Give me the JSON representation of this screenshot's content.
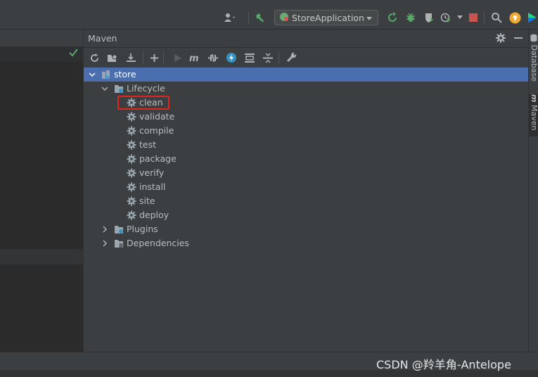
{
  "toolbar": {
    "run_config": "StoreApplication"
  },
  "maven": {
    "title": "Maven",
    "tree": [
      {
        "label": "store"
      },
      {
        "label": "Lifecycle"
      },
      {
        "label": "clean"
      },
      {
        "label": "validate"
      },
      {
        "label": "compile"
      },
      {
        "label": "test"
      },
      {
        "label": "package"
      },
      {
        "label": "verify"
      },
      {
        "label": "install"
      },
      {
        "label": "site"
      },
      {
        "label": "deploy"
      },
      {
        "label": "Plugins"
      },
      {
        "label": "Dependencies"
      }
    ]
  },
  "side_tabs": {
    "database": "Database",
    "maven": "Maven"
  },
  "watermark": "CSDN @羚羊角-Antelope",
  "colors": {
    "selection": "#4b6eaf",
    "highlight_box": "#e0261c",
    "panel_bg": "#3c3f41"
  }
}
